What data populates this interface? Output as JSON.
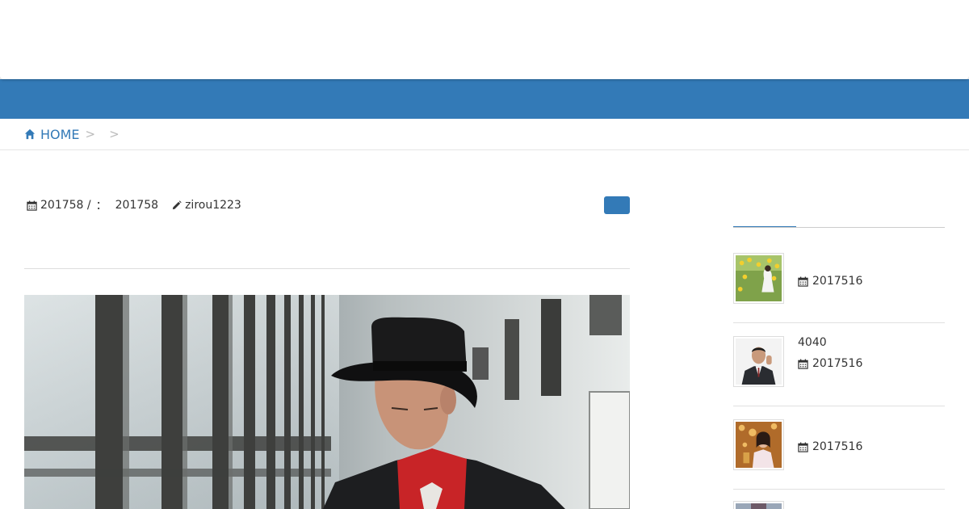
{
  "header": {
    "brand": ""
  },
  "breadcrumb": {
    "home_label": "HOME",
    "separators": [
      ">",
      ">"
    ]
  },
  "post": {
    "published": "201758 /",
    "modified_label": "：",
    "modified": "201758",
    "author": "zirou1223",
    "category_badge": ""
  },
  "sidebar": {
    "heading": "",
    "items": [
      {
        "title": "",
        "date": "2017516",
        "thumb": "woman-in-sunflower-field"
      },
      {
        "title": "4040",
        "date": "2017516",
        "thumb": "man-in-suit-waving"
      },
      {
        "title": "",
        "date": "2017516",
        "thumb": "woman-at-party"
      }
    ]
  },
  "colors": {
    "accent": "#337ab7",
    "text": "#333333",
    "divider": "#dddddd"
  }
}
